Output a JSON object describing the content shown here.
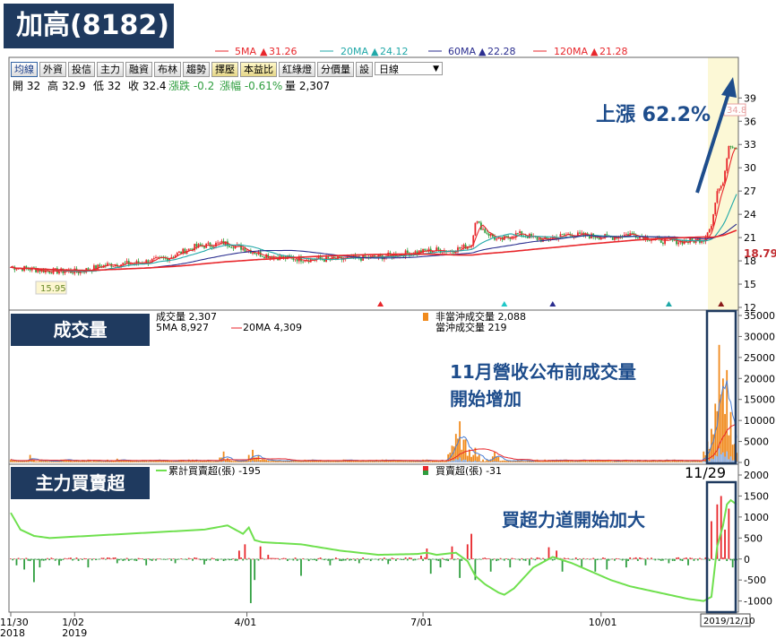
{
  "title": "加高(8182)",
  "colors": {
    "up": "#e8262b",
    "down": "#2f9e3f",
    "ma5": "#e8262b",
    "ma20": "#20a8a8",
    "ma60": "#2a2d8f",
    "ma120": "#e8262b",
    "navy": "#1f3a5f",
    "arrow": "#1e4d8c",
    "highlight": "#fcf8d6",
    "cumline": "#6fe04e",
    "orange": "#f08a1c",
    "blue": "#4a7fd6"
  },
  "ma_legend": [
    {
      "label": "5MA",
      "value": "31.26"
    },
    {
      "label": "20MA",
      "value": "24.12"
    },
    {
      "label": "60MA",
      "value": "22.28"
    },
    {
      "label": "120MA",
      "value": "21.28"
    }
  ],
  "toolbar": {
    "buttons": [
      "均線",
      "外資",
      "投信",
      "主力",
      "融資",
      "布林",
      "趨勢",
      "擇壓",
      "本益比",
      "紅綠燈",
      "分價量",
      "設"
    ],
    "period": "日線"
  },
  "ohlc": {
    "open": "開 32",
    "high": "高 32.9",
    "low": "低 32",
    "close": "收 32.4",
    "change": "漲跌 -0.2",
    "pct": "漲幅 -0.61%",
    "volume": "量 2,307"
  },
  "annotations": {
    "rise": "上漲 62.2%",
    "volume_note_l1": "11月營收公布前成交量",
    "volume_note_l2": "開始增加",
    "buy_note": "買超力道開始加大",
    "low_label": "15.95",
    "current_price": "18.79",
    "high_label": "34.8",
    "date_1129": "11/29",
    "date_box": "2019/12/10"
  },
  "volume_legend": {
    "vol": "成交量 2,307",
    "ma5": "5MA 8,927",
    "ma20": "20MA 4,309",
    "non_day": "非當沖成交量 2,088",
    "day": "當沖成交量 219"
  },
  "main_legend": {
    "cum": "累計買賣超(張) -195",
    "net": "買賣超(張) -31"
  },
  "pane_labels": {
    "volume": "成交量",
    "main": "主力買賣超"
  },
  "x_labels": [
    {
      "l1": "11/30",
      "l2": "2018",
      "day": 0
    },
    {
      "l1": "1/02",
      "l2": "2019",
      "day": 33
    },
    {
      "l1": "4/01",
      "l2": "",
      "day": 122
    },
    {
      "l1": "7/01",
      "l2": "",
      "day": 213
    },
    {
      "l1": "10/01",
      "l2": "",
      "day": 305
    }
  ],
  "chart_data": [
    {
      "type": "candlestick",
      "title": "",
      "days": 375,
      "ylim": [
        12,
        41
      ],
      "yticks": [
        "12",
        "15",
        "18",
        "21",
        "24",
        "27",
        "30",
        "33",
        "36",
        "39"
      ],
      "closes": [
        [
          0,
          17.2
        ],
        [
          20,
          16.7
        ],
        [
          35,
          16.6
        ],
        [
          50,
          17.5
        ],
        [
          65,
          17.7
        ],
        [
          80,
          18.3
        ],
        [
          95,
          19.8
        ],
        [
          110,
          20.3
        ],
        [
          118,
          19.8
        ],
        [
          130,
          18.8
        ],
        [
          140,
          18.4
        ],
        [
          155,
          18.2
        ],
        [
          170,
          18.2
        ],
        [
          190,
          18.5
        ],
        [
          205,
          19.0
        ],
        [
          220,
          19.4
        ],
        [
          228,
          19.3
        ],
        [
          238,
          20.1
        ],
        [
          240,
          23.2
        ],
        [
          245,
          21.8
        ],
        [
          252,
          20.6
        ],
        [
          262,
          21.5
        ],
        [
          275,
          20.7
        ],
        [
          288,
          21.4
        ],
        [
          300,
          21.2
        ],
        [
          310,
          21.0
        ],
        [
          320,
          21.5
        ],
        [
          335,
          20.6
        ],
        [
          350,
          20.5
        ],
        [
          358,
          20.8
        ],
        [
          362,
          22.5
        ],
        [
          365,
          27.0
        ],
        [
          368,
          28.0
        ],
        [
          371,
          32.8
        ],
        [
          375,
          32.4
        ]
      ],
      "ma": [
        {
          "name": "5MA",
          "color": "#e8262b"
        },
        {
          "name": "20MA",
          "color": "#20a8a8"
        },
        {
          "name": "60MA",
          "color": "#2a2d8f"
        },
        {
          "name": "120MA",
          "color": "#e8262b"
        }
      ],
      "markers": [
        {
          "day": 191,
          "color": "#e8262b"
        },
        {
          "day": 255,
          "color": "#20c8c8"
        },
        {
          "day": 280,
          "color": "#2a2d8f"
        },
        {
          "day": 340,
          "color": "#20a8a8"
        },
        {
          "day": 367,
          "color": "#8a1a1a"
        }
      ]
    },
    {
      "type": "bar",
      "title": "",
      "series": [
        {
          "name": "非當沖成交量",
          "color": "#f08a1c"
        },
        {
          "name": "當沖成交量"
        }
      ],
      "ylim": [
        0,
        35000
      ],
      "yticks": [
        "0",
        "5000",
        "10000",
        "15000",
        "20000",
        "25000",
        "30000",
        "35000"
      ],
      "spikes": [
        [
          10,
          1800
        ],
        [
          55,
          900
        ],
        [
          110,
          2600
        ],
        [
          125,
          3000
        ],
        [
          128,
          1800
        ],
        [
          228,
          4000
        ],
        [
          230,
          6800
        ],
        [
          232,
          9800
        ],
        [
          235,
          5500
        ],
        [
          240,
          3500
        ],
        [
          250,
          2500
        ],
        [
          360,
          5000
        ],
        [
          362,
          8000
        ],
        [
          364,
          14000
        ],
        [
          366,
          28000
        ],
        [
          368,
          20000
        ],
        [
          370,
          22000
        ],
        [
          372,
          12000
        ],
        [
          375,
          2307
        ]
      ]
    },
    {
      "type": "bar",
      "title": "",
      "ylim": [
        -1200,
        2000
      ],
      "yticks": [
        "-1000",
        "-500",
        "0",
        "500",
        "1000",
        "1500",
        "2000"
      ],
      "bars": [
        [
          3,
          -150
        ],
        [
          7,
          -250
        ],
        [
          12,
          -550
        ],
        [
          15,
          -200
        ],
        [
          25,
          -150
        ],
        [
          40,
          -200
        ],
        [
          55,
          -100
        ],
        [
          70,
          -150
        ],
        [
          85,
          -100
        ],
        [
          100,
          -130
        ],
        [
          118,
          200
        ],
        [
          121,
          350
        ],
        [
          124,
          -1050
        ],
        [
          126,
          -500
        ],
        [
          129,
          300
        ],
        [
          133,
          100
        ],
        [
          150,
          -400
        ],
        [
          165,
          -150
        ],
        [
          180,
          -100
        ],
        [
          195,
          -120
        ],
        [
          212,
          80
        ],
        [
          215,
          250
        ],
        [
          217,
          -350
        ],
        [
          222,
          -200
        ],
        [
          228,
          300
        ],
        [
          232,
          -450
        ],
        [
          236,
          350
        ],
        [
          238,
          600
        ],
        [
          240,
          -500
        ],
        [
          248,
          -300
        ],
        [
          258,
          -200
        ],
        [
          268,
          -150
        ],
        [
          278,
          280
        ],
        [
          282,
          200
        ],
        [
          285,
          -300
        ],
        [
          295,
          -200
        ],
        [
          302,
          -300
        ],
        [
          308,
          -250
        ],
        [
          318,
          -200
        ],
        [
          328,
          -150
        ],
        [
          340,
          -100
        ],
        [
          350,
          -150
        ],
        [
          362,
          900
        ],
        [
          365,
          1300
        ],
        [
          367,
          1500
        ],
        [
          369,
          700
        ],
        [
          371,
          1200
        ],
        [
          373,
          -200
        ],
        [
          375,
          -31
        ]
      ],
      "cum": [
        [
          0,
          1100
        ],
        [
          5,
          700
        ],
        [
          12,
          550
        ],
        [
          20,
          500
        ],
        [
          40,
          550
        ],
        [
          60,
          600
        ],
        [
          80,
          650
        ],
        [
          100,
          700
        ],
        [
          112,
          800
        ],
        [
          120,
          600
        ],
        [
          123,
          750
        ],
        [
          126,
          450
        ],
        [
          130,
          400
        ],
        [
          150,
          350
        ],
        [
          170,
          200
        ],
        [
          190,
          100
        ],
        [
          210,
          120
        ],
        [
          215,
          150
        ],
        [
          220,
          100
        ],
        [
          230,
          150
        ],
        [
          236,
          -50
        ],
        [
          240,
          -400
        ],
        [
          245,
          -600
        ],
        [
          252,
          -800
        ],
        [
          255,
          -850
        ],
        [
          260,
          -700
        ],
        [
          270,
          -200
        ],
        [
          280,
          50
        ],
        [
          290,
          -100
        ],
        [
          300,
          -300
        ],
        [
          310,
          -500
        ],
        [
          320,
          -650
        ],
        [
          330,
          -750
        ],
        [
          340,
          -850
        ],
        [
          350,
          -950
        ],
        [
          358,
          -1000
        ],
        [
          362,
          -900
        ],
        [
          365,
          300
        ],
        [
          368,
          800
        ],
        [
          370,
          1300
        ],
        [
          372,
          1400
        ],
        [
          375,
          1300
        ]
      ]
    }
  ]
}
